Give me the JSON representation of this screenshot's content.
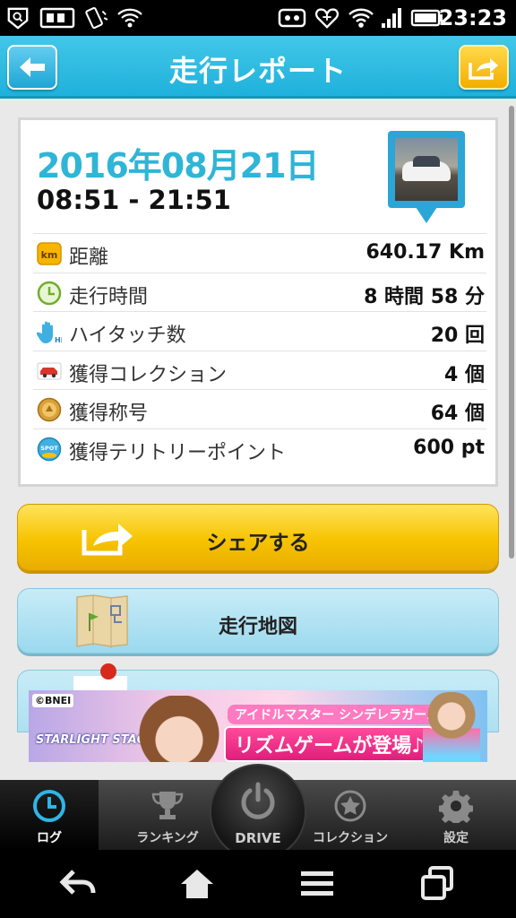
{
  "status_bar": {
    "time": "23:23",
    "icons": [
      "search-badge-icon",
      "sim-icon",
      "vibrate-icon",
      "wifi-icon",
      "mask-icon",
      "heart-icon",
      "wifi-icon",
      "signal-icon",
      "battery-icon"
    ]
  },
  "header": {
    "title": "走行レポート",
    "back_icon": "back-arrow-icon",
    "share_icon": "share-icon"
  },
  "report": {
    "date": "2016年08月21日",
    "time_range": "08:51 - 21:51",
    "stats": [
      {
        "icon": "km-icon",
        "label": "距離",
        "value": "640.17 Km"
      },
      {
        "icon": "clock-icon",
        "label": "走行時間",
        "value": "8 時間 58 分"
      },
      {
        "icon": "hand-icon",
        "label": "ハイタッチ数",
        "value": "20 回"
      },
      {
        "icon": "car-icon",
        "label": "獲得コレクション",
        "value": "4 個"
      },
      {
        "icon": "medal-icon",
        "label": "獲得称号",
        "value": "64 個"
      },
      {
        "icon": "spot-icon",
        "label": "獲得テリトリーポイント",
        "value": "600 pt"
      }
    ]
  },
  "actions": {
    "share_label": "シェアする",
    "map_label": "走行地図"
  },
  "ad": {
    "logo": "©BNEI",
    "brand": "STARLIGHT STAGE",
    "subtitle": "アイドルマスター シンデレラガールズの",
    "headline": "リズムゲームが登場♪"
  },
  "tabs": [
    {
      "label": "ログ",
      "icon": "clock-icon",
      "active": true
    },
    {
      "label": "ランキング",
      "icon": "trophy-icon",
      "active": false
    },
    {
      "label": "DRIVE",
      "icon": "power-icon",
      "active": false
    },
    {
      "label": "コレクション",
      "icon": "star-icon",
      "active": false
    },
    {
      "label": "設定",
      "icon": "gear-icon",
      "active": false
    }
  ],
  "colors": {
    "header": "#1fb1dc",
    "accent": "#2fb5d6",
    "share_button": "#f6c300",
    "map_button": "#9bd9ee"
  }
}
